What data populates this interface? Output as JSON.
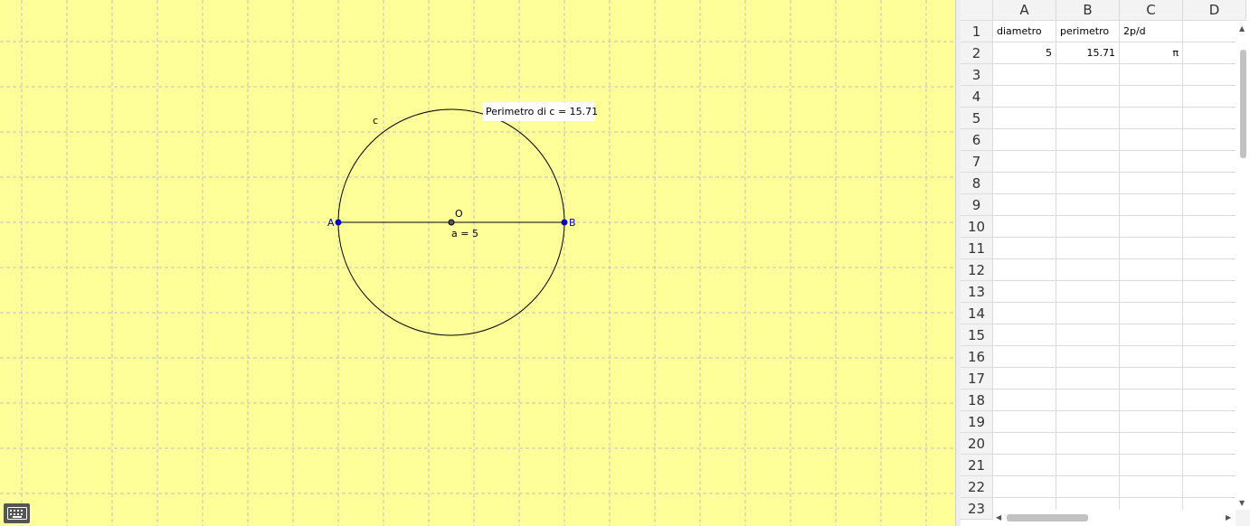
{
  "graphics": {
    "circle_label": "c",
    "center_label": "O",
    "point_a_label": "A",
    "point_b_label": "B",
    "segment_label": "a = 5",
    "perimeter_caption": "Perimetro di c = 15.71",
    "colors": {
      "background": "#ffff99",
      "grid": "#c0c0c0",
      "point": "#0000cc",
      "stroke": "#000000"
    }
  },
  "keyboard_icon": "keyboard-icon",
  "spreadsheet": {
    "columns": [
      "A",
      "B",
      "C",
      "D"
    ],
    "rows": [
      "1",
      "2",
      "3",
      "4",
      "5",
      "6",
      "7",
      "8",
      "9",
      "10",
      "11",
      "12",
      "13",
      "14",
      "15",
      "16",
      "17",
      "18",
      "19",
      "20",
      "21",
      "22",
      "23"
    ],
    "cells": {
      "A1": "diametro",
      "B1": "perimetro",
      "C1": "2p/d",
      "A2": "5",
      "B2": "15.71",
      "C2": "π"
    },
    "scroll_up_icon": "▲",
    "scroll_down_icon": "▼",
    "scroll_left_icon": "◀",
    "scroll_right_icon": "▶"
  }
}
